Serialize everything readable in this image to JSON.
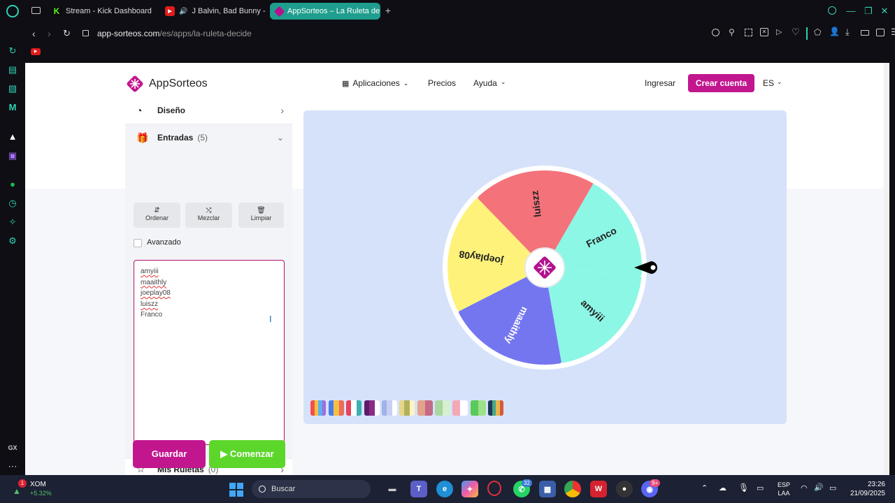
{
  "browser": {
    "tabs": [
      {
        "label": "Stream - Kick Dashboard",
        "icon": "kick-icon"
      },
      {
        "label": "J Balvin, Bad Bunny -",
        "icon": "youtube-icon"
      },
      {
        "label": "AppSorteos – La Ruleta de",
        "icon": "appsorteos-icon"
      }
    ],
    "url_host": "app-sorteos.com",
    "url_path": "/es/apps/la-ruleta-decide"
  },
  "nav": {
    "logo": "AppSorteos",
    "aplicaciones": "Aplicaciones",
    "precios": "Precios",
    "ayuda": "Ayuda",
    "ingresar": "Ingresar",
    "crear_cuenta": "Crear cuenta",
    "lang": "ES"
  },
  "panel": {
    "diseno": "Diseño",
    "entradas": "Entradas",
    "entradas_count": "(5)",
    "ordenar": "Ordenar",
    "mezclar": "Mezclar",
    "limpiar": "Limpiar",
    "avanzado": "Avanzado",
    "entries": [
      "amyiii",
      "maaithly",
      "joeplay08",
      "luiszz",
      "Franco"
    ],
    "mis_ruletas": "Mis Ruletas",
    "mis_ruletas_count": "(0)",
    "guardar": "Guardar",
    "comenzar": "Comenzar"
  },
  "wheel": {
    "segments": [
      {
        "label": "Franco",
        "color": "#8cf7e5"
      },
      {
        "label": "amyiii",
        "color": "#8cf7e5"
      },
      {
        "label": "maaithly",
        "color": "#7476f0"
      },
      {
        "label": "joeplay08",
        "color": "#fef27a"
      },
      {
        "label": "luiszz",
        "color": "#f4727a"
      }
    ]
  },
  "taskbar": {
    "stock_symbol": "XOM",
    "stock_change": "+5.32%",
    "stock_badge": "1",
    "search": "Buscar",
    "whatsapp_badge": "32",
    "discord_badge": "9+",
    "lang_line1": "ESP",
    "lang_line2": "LAA",
    "time": "23:26",
    "date": "21/09/2025"
  }
}
